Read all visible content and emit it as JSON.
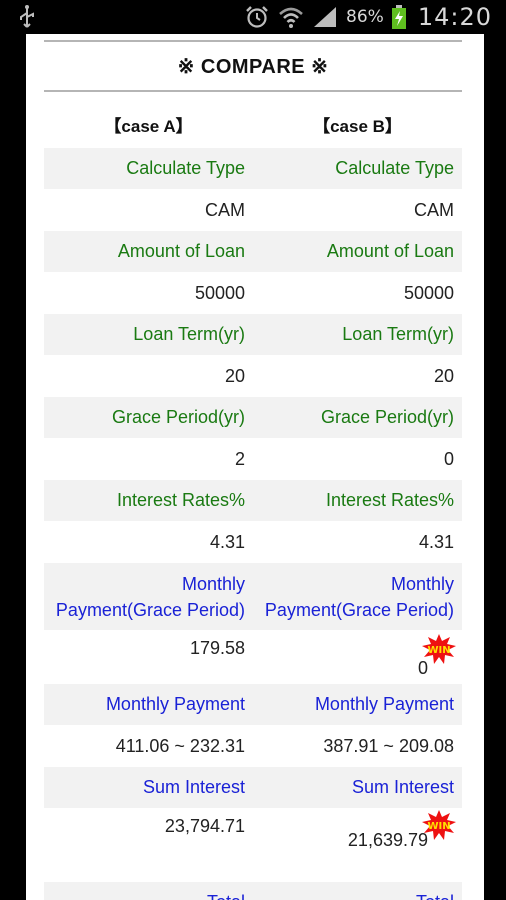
{
  "status_bar": {
    "battery": "86%",
    "time": "14:20"
  },
  "title": "※ COMPARE ※",
  "cases": [
    "【case A】",
    "【case B】"
  ],
  "win_label": "WIN",
  "rows": [
    {
      "label": "Calculate Type",
      "a": "CAM",
      "b": "CAM",
      "label_color": "green"
    },
    {
      "label": "Amount of Loan",
      "a": "50000",
      "b": "50000",
      "label_color": "green"
    },
    {
      "label": "Loan Term(yr)",
      "a": "20",
      "b": "20",
      "label_color": "green"
    },
    {
      "label": "Grace Period(yr)",
      "a": "2",
      "b": "0",
      "label_color": "green"
    },
    {
      "label": "Interest Rates%",
      "a": "4.31",
      "b": "4.31",
      "label_color": "green"
    },
    {
      "label_line1": "Monthly",
      "label_line2": "Payment(Grace Period)",
      "a": "179.58",
      "b": "0",
      "winner": "b",
      "label_color": "blue"
    },
    {
      "label": "Monthly Payment",
      "a": "411.06 ~ 232.31",
      "b": "387.91 ~ 209.08",
      "label_color": "blue"
    },
    {
      "label": "Sum Interest",
      "a": "23,794.71",
      "b": "21,639.79",
      "winner": "b",
      "label_color": "blue"
    },
    {
      "label": "Total",
      "label_color": "blue"
    }
  ],
  "colors": {
    "green_label": "#1a7a12",
    "blue_label": "#1a22d6",
    "label_bg": "#f2f2f2"
  }
}
